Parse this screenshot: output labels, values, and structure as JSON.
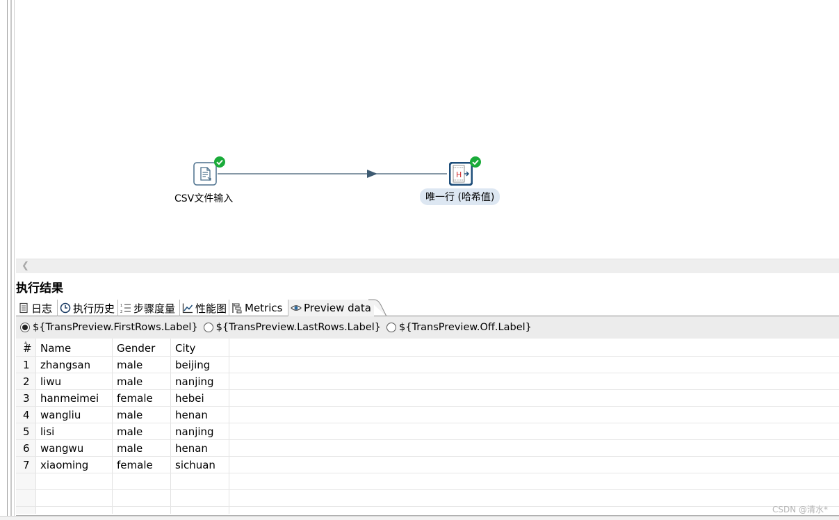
{
  "canvas": {
    "steps": [
      {
        "label": "CSV文件输入",
        "icon": "csv-file-input-icon",
        "status": "success"
      },
      {
        "label": "唯一行 (哈希值)",
        "icon": "unique-rows-hash-icon",
        "status": "success",
        "selected": true
      }
    ],
    "hop": {
      "from": "CSV文件输入",
      "to": "唯一行 (哈希值)"
    }
  },
  "results": {
    "title": "执行结果",
    "tabs": [
      {
        "label": "日志",
        "icon": "log-icon"
      },
      {
        "label": "执行历史",
        "icon": "history-clock-icon"
      },
      {
        "label": "步骤度量",
        "icon": "step-metrics-icon"
      },
      {
        "label": "性能图",
        "icon": "performance-chart-icon"
      },
      {
        "label": "Metrics",
        "icon": "metrics-icon"
      },
      {
        "label": "Preview data",
        "icon": "eye-icon",
        "active": true
      }
    ],
    "preview_options": [
      {
        "label": "${TransPreview.FirstRows.Label}",
        "checked": true
      },
      {
        "label": "${TransPreview.LastRows.Label}",
        "checked": false
      },
      {
        "label": "${TransPreview.Off.Label}",
        "checked": false
      }
    ],
    "table": {
      "columns": [
        "#",
        "Name",
        "Gender",
        "City"
      ],
      "rows": [
        [
          "1",
          "zhangsan",
          "male",
          "beijing"
        ],
        [
          "2",
          "liwu",
          "male",
          "nanjing"
        ],
        [
          "3",
          "hanmeimei",
          "female",
          "hebei"
        ],
        [
          "4",
          "wangliu",
          "male",
          "henan"
        ],
        [
          "5",
          "lisi",
          "male",
          "nanjing"
        ],
        [
          "6",
          "wangwu",
          "male",
          "henan"
        ],
        [
          "7",
          "xiaoming",
          "female",
          "sichuan"
        ]
      ]
    }
  },
  "watermark": "CSDN @清水*",
  "colors": {
    "success": "#1aab3a",
    "hop": "#3e5b72",
    "selected_bg": "#dde7f2"
  }
}
